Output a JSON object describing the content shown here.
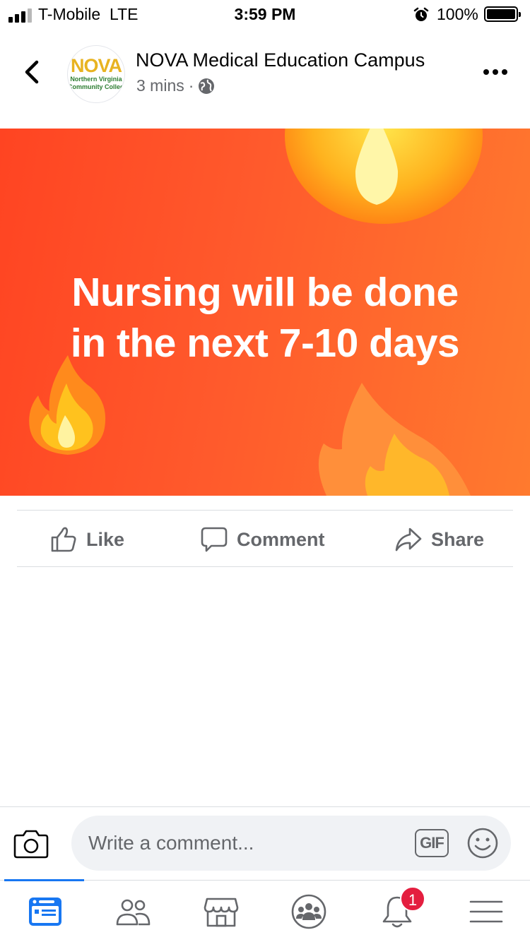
{
  "status_bar": {
    "carrier": "T-Mobile",
    "network": "LTE",
    "time": "3:59 PM",
    "battery": "100%",
    "signal_bars_filled": 3,
    "signal_bars_total": 4,
    "icons": [
      "signal-icon",
      "alarm-icon",
      "battery-icon"
    ]
  },
  "header": {
    "page_name": "NOVA Medical Education Campus",
    "time_ago": "3 mins",
    "separator": "·",
    "privacy_icon": "globe-icon",
    "avatar": {
      "logo_text": "NOVA",
      "logo_subtext_line1": "Northern Virginia",
      "logo_subtext_line2": "Community College"
    }
  },
  "post": {
    "line1": "Nursing will be done",
    "line2": "in the next 7-10 days",
    "background_colors": [
      "#ff4422",
      "#ff7a2e"
    ],
    "decorations": [
      "fire-emoji",
      "fire-emoji",
      "fire-emoji"
    ]
  },
  "actions": {
    "like": "Like",
    "comment": "Comment",
    "share": "Share"
  },
  "comment_bar": {
    "placeholder": "Write a comment...",
    "gif_label": "GIF"
  },
  "tab_bar": {
    "tabs": [
      "news-feed-icon",
      "friends-icon",
      "marketplace-icon",
      "groups-icon",
      "notifications-icon",
      "menu-icon"
    ],
    "active_tab": "news-feed-icon",
    "notification_count": "1"
  },
  "colors": {
    "accent": "#1877f2",
    "badge": "#e41e3f",
    "muted_text": "#65676b"
  }
}
